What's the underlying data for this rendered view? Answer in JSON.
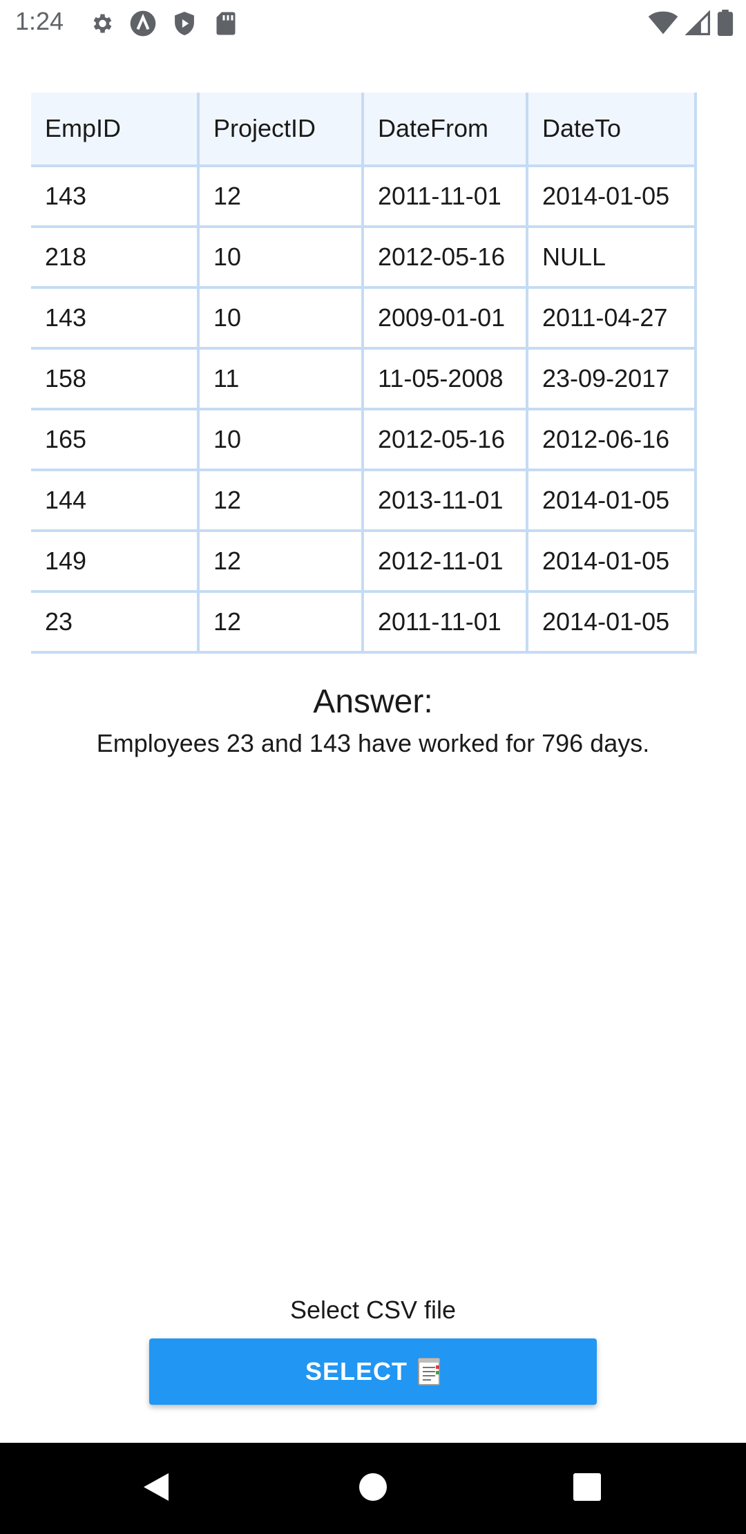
{
  "status_bar": {
    "time": "1:24",
    "left_icons": [
      "settings-gear-icon",
      "app-a-icon",
      "shield-play-icon",
      "sd-card-icon"
    ],
    "right_icons": [
      "wifi-icon",
      "cell-signal-icon",
      "battery-icon"
    ]
  },
  "table": {
    "headers": [
      "EmpID",
      "ProjectID",
      "DateFrom",
      "DateTo"
    ],
    "rows": [
      [
        "143",
        "12",
        "2011-11-01",
        "2014-01-05"
      ],
      [
        "218",
        "10",
        "2012-05-16",
        "NULL"
      ],
      [
        "143",
        "10",
        "2009-01-01",
        "2011-04-27"
      ],
      [
        "158",
        "11",
        "11-05-2008",
        "23-09-2017"
      ],
      [
        "165",
        "10",
        "2012-05-16",
        "2012-06-16"
      ],
      [
        "144",
        "12",
        "2013-11-01",
        "2014-01-05"
      ],
      [
        "149",
        "12",
        "2012-11-01",
        "2014-01-05"
      ],
      [
        "23",
        "12",
        "2011-11-01",
        "2014-01-05"
      ]
    ]
  },
  "answer": {
    "heading": "Answer:",
    "text": "Employees 23 and 143 have worked for 796 days."
  },
  "csv": {
    "label": "Select CSV file",
    "button_label": "SELECT",
    "button_icon": "document-icon"
  },
  "colors": {
    "accent": "#2196f3",
    "table_border": "#c6dbf3",
    "header_bg": "#f0f6fe"
  },
  "nav": [
    "back-icon",
    "home-icon",
    "recents-icon"
  ]
}
